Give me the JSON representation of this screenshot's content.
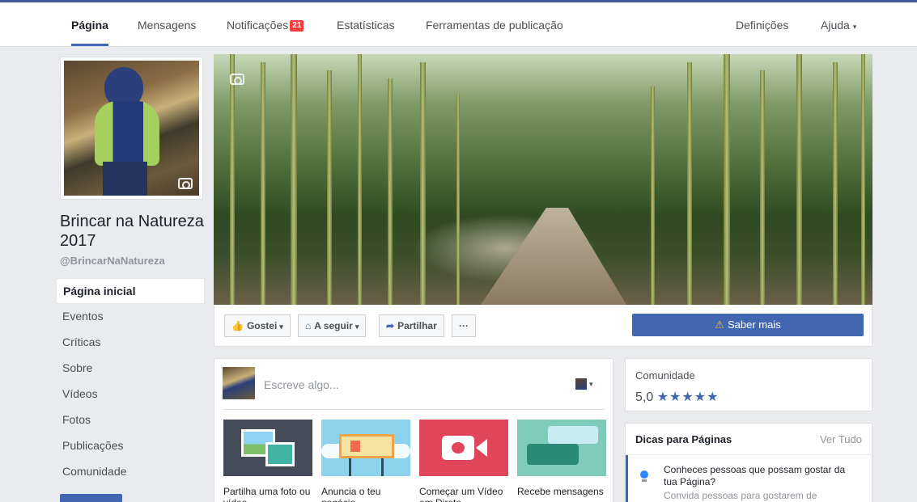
{
  "tabs": [
    {
      "label": "Página",
      "active": true
    },
    {
      "label": "Mensagens"
    },
    {
      "label": "Notificações",
      "badge": "21"
    },
    {
      "label": "Estatísticas"
    },
    {
      "label": "Ferramentas de publicação"
    }
  ],
  "tabs_right": {
    "settings": "Definições",
    "help": "Ajuda",
    "help_caret": "▾"
  },
  "page": {
    "name": "Brincar na Natureza 2017",
    "handle": "@BrincarNaNatureza"
  },
  "left_nav": [
    "Página inicial",
    "Eventos",
    "Críticas",
    "Sobre",
    "Vídeos",
    "Fotos",
    "Publicações",
    "Comunidade"
  ],
  "actions": {
    "like": "Gostei",
    "follow": "A seguir",
    "share": "Partilhar",
    "more": "···",
    "caret": "▾",
    "like_icon": "👍",
    "follow_icon": "⌂",
    "share_icon": "➦",
    "cta": "Saber mais",
    "cta_icon": "⚠"
  },
  "composer": {
    "placeholder": "Escreve algo...",
    "selector_caret": "▾",
    "tiles": [
      "Partilha uma foto ou vídeo",
      "Anuncia o teu negócio",
      "Começar um Vídeo em Direto",
      "Recebe mensagens"
    ]
  },
  "community": {
    "title": "Comunidade",
    "rating": "5,0",
    "stars": "★★★★★",
    "rating_value": 5.0
  },
  "tips": {
    "title": "Dicas para Páginas",
    "link": "Ver Tudo",
    "item_text": "Conheces pessoas que possam gostar da tua Página?",
    "item_sub": "Convida pessoas para gostarem de"
  },
  "colors": {
    "brand": "#4267b2",
    "badge": "#fa3e3e",
    "background": "#e9ebee"
  }
}
